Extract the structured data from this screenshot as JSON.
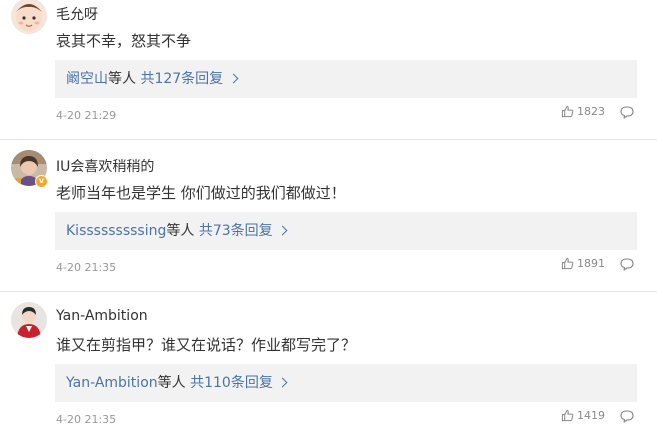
{
  "comments": [
    {
      "username": "毛允呀",
      "text": "哀其不幸，怒其不争",
      "reply_user": "阚空山",
      "reply_mid": "等人",
      "reply_count": "共127条回复",
      "time": "4-20 21:29",
      "likes": "1823",
      "avatar_icon": "baby-face-avatar",
      "verified": false
    },
    {
      "username": "IU会喜欢稍稍的",
      "text": "老师当年也是学生 你们做过的我们都做过！",
      "reply_user": "Kisssssssssing",
      "reply_mid": "等人",
      "reply_count": "共73条回复",
      "time": "4-20 21:35",
      "likes": "1891",
      "avatar_icon": "girl-portrait-avatar",
      "verified": true,
      "badge": "v"
    },
    {
      "username": "Yan-Ambition",
      "text": "谁又在剪指甲？谁又在说话？作业都写完了？",
      "reply_user": "Yan-Ambition",
      "reply_mid": "等人",
      "reply_count": "共110条回复",
      "time": "4-20 21:35",
      "likes": "1419",
      "avatar_icon": "red-figure-avatar",
      "verified": false
    }
  ],
  "colors": {
    "link": "#4b73a8",
    "reply_bg": "#f2f2f2",
    "meta": "#999999",
    "badge": "#f5a623"
  }
}
